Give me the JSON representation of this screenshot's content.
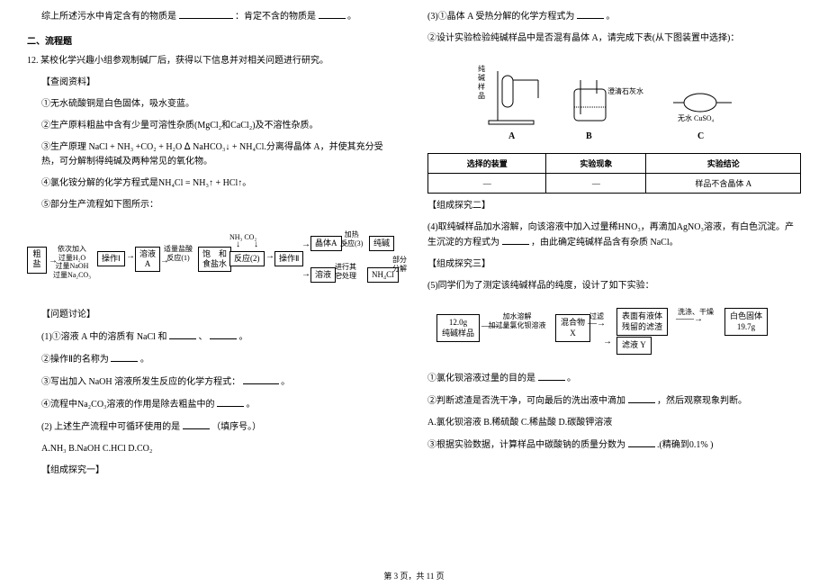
{
  "col1": {
    "line1_a": "综上所述污水中肯定含有的物质是",
    "line1_b": "：肯定不含的物质是",
    "line1_c": "。",
    "section2": "二、流程题",
    "q12_intro": "某校化学兴趣小组参观制碱厂后，获得以下信息并对相关问题进行研究。",
    "q12_num": "12.",
    "lookup": "【查阅资料】",
    "info1": "①无水硫酸铜是白色固体，吸水变蓝。",
    "info2": "②生产原料粗盐中含有少量可溶性杂质(MgCl₂和CaCl₂)及不溶性杂质。",
    "info3": "③生产原理  NaCl + NH₃ +CO₂ + H₂O ᐃ NaHCO₃↓ + NH₄Cl.分离得晶体 A，并使其充分受热，可分解制得纯碱及两种常见的氧化物。",
    "info4": "④氯化铵分解的化学方程式是NH₄Cl = NH₃↑ + HCl↑。",
    "info5": "⑤部分生产流程如下图所示：",
    "flow_cuyan": "粗\n盐",
    "flow_step1_label": "依次加入\n过量H₂O\n过量NaOH\n过量Na₂CO₃",
    "flow_op1": "操作Ⅰ",
    "flow_rongyea": "溶液\nA",
    "flow_hcl": "适量盐酸\n反应(1)",
    "flow_bh": "饱　和\n食盐水",
    "flow_nh3co2": "NH₃  CO₂",
    "flow_reaction": "反应(2)",
    "flow_op2": "操作Ⅱ",
    "flow_jingti": "晶体A",
    "flow_jiare": "加热\n反应(3)",
    "flow_chunjian": "纯碱",
    "flow_rongye2": "溶液",
    "flow_process": "进行其\n它处理",
    "flow_nh4cl": "NH₄Cl",
    "flow_bufen": "部分\n分解",
    "discuss": "【问题讨论】",
    "q1_1": "(1)①溶液 A 中的溶质有 NaCl 和",
    "q1_1b": "、",
    "q1_1c": "。",
    "q1_2": "②操作Ⅱ的名称为",
    "q1_2b": "。",
    "q1_3": "③写出加入 NaOH 溶液所发生反应的化学方程式：",
    "q1_3b": "。",
    "q1_4": "④流程中Na₂CO₃溶液的作用是除去粗盐中的",
    "q1_4b": "。",
    "q2": "(2) 上述生产流程中可循环使用的是",
    "q2b": "（填序号。）",
    "q2_opts": "A.NH₃         B.NaOH C.HCl D.CO₂",
    "explore": "【组成探究一】"
  },
  "col2": {
    "q3_1": "(3)①晶体 A 受热分解的化学方程式为",
    "q3_1b": "。",
    "q3_2": "②设计实验检验纯碱样品中是否混有晶体 A，请完成下表(从下图装置中选择)：",
    "apparatus_label1": "纯\n碱\n样\n品",
    "apparatus_label2": "澄清石灰水",
    "apparatus_label3": "无水 CuSO₄",
    "apparatus_a": "A",
    "apparatus_b": "B",
    "apparatus_c": "C",
    "th1": "选择的装置",
    "th2": "实验现象",
    "th3": "实验结论",
    "td1": "—",
    "td2": "—",
    "td3": "样品不含晶体 A",
    "explore2": "【组成探究二】",
    "q4": "(4)取纯碱样品加水溶解，向该溶液中加入过量稀HNO₃，再滴加AgNO₃溶液，有白色沉淀。产生沉淀的方程式为",
    "q4b": "，由此确定纯碱样品含有杂质 NaCl。",
    "explore3": "【组成探究三】",
    "q5": "(5)同学们为了测定该纯碱样品的纯度，设计了如下实验：",
    "f2_box1a": "12.0g",
    "f2_box1b": "纯碱样品",
    "f2_step1": "加水溶解\n加过量氯化钡溶液",
    "f2_box2": "混合物\nX",
    "f2_filter": "过滤",
    "f2_residue": "表面有液体\n残留的滤渣",
    "f2_wash": "洗涤、干燥",
    "f2_box3a": "白色固体",
    "f2_box3b": "19.7g",
    "f2_filtrate": "滤液 Y",
    "q5_1": "①氯化钡溶液过量的目的是",
    "q5_1b": "。",
    "q5_2": "②判断滤渣是否洗干净，可向最后的洗出液中滴加",
    "q5_2b": "，然后观察现象判断。",
    "q5_opts": "A.氯化钡溶液      B.稀硫酸         C.稀盐酸         D.碳酸钾溶液",
    "q5_3": "③根据实验数据，计算样品中碳酸钠的质量分数为",
    "q5_3b": ".(精确到0.1% )"
  },
  "footer": "第 3 页，共 11 页"
}
